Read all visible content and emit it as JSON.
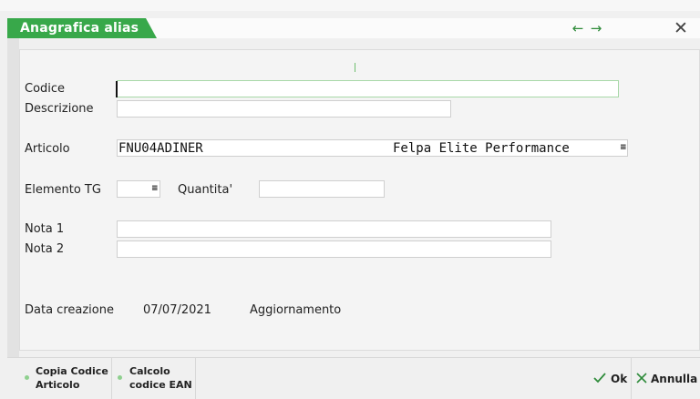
{
  "window": {
    "title": "Anagrafica alias"
  },
  "form": {
    "codice_label": "Codice",
    "codice_value": "",
    "descrizione_label": "Descrizione",
    "descrizione_value": "",
    "articolo_label": "Articolo",
    "articolo_code": "FNU04ADINER",
    "articolo_desc": "Felpa Elite Performance",
    "elemento_label": "Elemento TG",
    "quantita_label": "Quantita'",
    "quantita_value": "",
    "nota1_label": "Nota 1",
    "nota1_value": "",
    "nota2_label": "Nota 2",
    "nota2_value": "",
    "data_creazione_label": "Data creazione",
    "data_creazione_value": "07/07/2021",
    "aggiornamento_label": "Aggiornamento"
  },
  "footer": {
    "copia_line1": "Copia Codice",
    "copia_line2": "Articolo",
    "calcolo_line1": "Calcolo",
    "calcolo_line2": "codice EAN",
    "ok_label": "Ok",
    "annulla_label": "Annulla"
  },
  "colors": {
    "accent": "#38a84a",
    "accent_light": "#8fd08f"
  },
  "icons": [
    "arrow-left-icon",
    "arrow-right-icon",
    "close-icon",
    "menu-dots-icon",
    "check-icon",
    "x-icon"
  ]
}
